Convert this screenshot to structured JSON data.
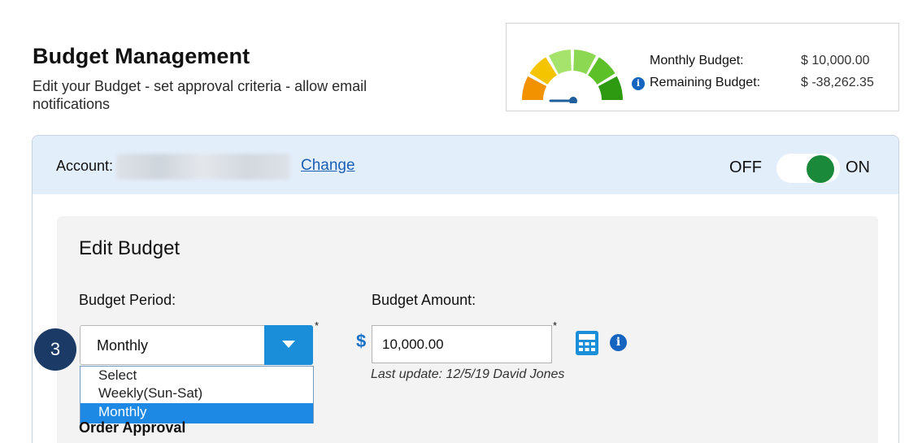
{
  "header": {
    "title": "Budget Management",
    "subtitle": "Edit your Budget - set approval criteria - allow email notifications"
  },
  "summary": {
    "monthly_label": "Monthly Budget:",
    "monthly_value": "$ 10,000.00",
    "remaining_label": "Remaining Budget:",
    "remaining_value": "$ -38,262.35",
    "info_glyph": "i",
    "gauge_colors": [
      "#f39200",
      "#f5c400",
      "#a6e36d",
      "#8cd852",
      "#5cc128",
      "#2e9a12"
    ],
    "gauge_needle_color": "#1f5f9c"
  },
  "account": {
    "label": "Account:",
    "change_link": "Change",
    "toggle_off_label": "OFF",
    "toggle_on_label": "ON",
    "toggle_state": "on",
    "toggle_color": "#1a8a3a"
  },
  "edit_budget": {
    "title": "Edit Budget",
    "period_label": "Budget Period:",
    "period_selected": "Monthly",
    "period_options": [
      "Select",
      "Weekly(Sun-Sat)",
      "Monthly"
    ],
    "period_highlighted": "Monthly",
    "required_mark": "*",
    "amount_label": "Budget Amount:",
    "currency_symbol": "$",
    "amount_value": "10,000.00",
    "last_update": "Last update: 12/5/19 David Jones",
    "next_section_label": "Order Approval",
    "info_glyph": "i",
    "accent_color": "#1a8ed8"
  },
  "step_badge": {
    "number": "3",
    "color": "#1c3a66"
  }
}
